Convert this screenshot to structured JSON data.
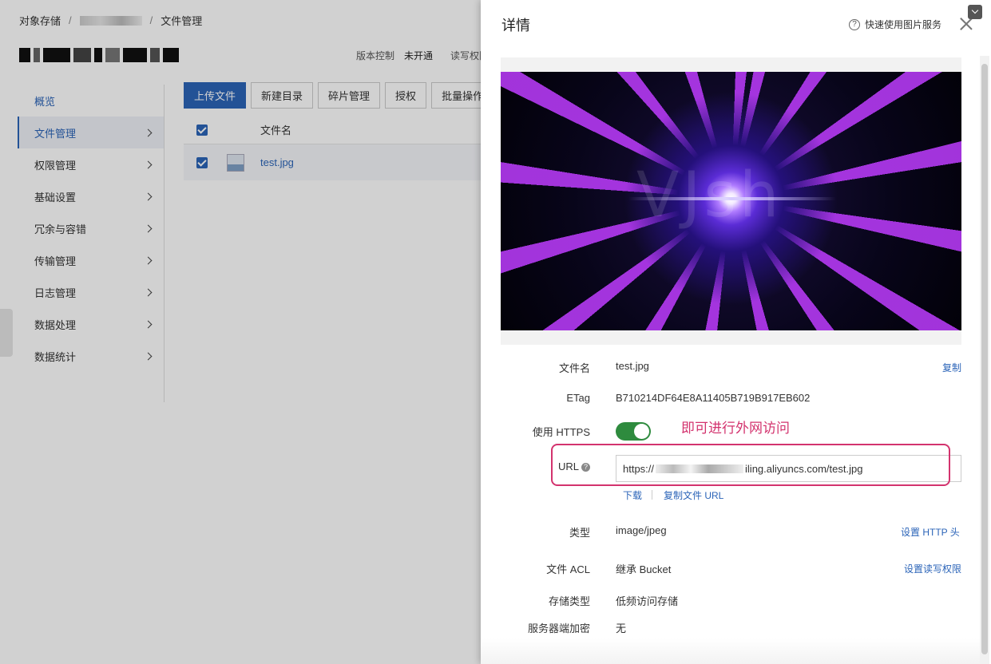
{
  "breadcrumb": {
    "root": "对象存储",
    "sep": "/",
    "current": "文件管理"
  },
  "bucket": {
    "version_label": "版本控制",
    "version_value": "未开通",
    "rw_label": "读写权限"
  },
  "sidebar": {
    "items": [
      {
        "label": "概览"
      },
      {
        "label": "文件管理"
      },
      {
        "label": "权限管理"
      },
      {
        "label": "基础设置"
      },
      {
        "label": "冗余与容错"
      },
      {
        "label": "传输管理"
      },
      {
        "label": "日志管理"
      },
      {
        "label": "数据处理"
      },
      {
        "label": "数据统计"
      }
    ]
  },
  "toolbar": {
    "upload": "上传文件",
    "new_dir": "新建目录",
    "fragments": "碎片管理",
    "authorize": "授权",
    "batch": "批量操作"
  },
  "table": {
    "col_name": "文件名",
    "rows": [
      {
        "name": "test.jpg",
        "checked": true
      }
    ]
  },
  "drawer": {
    "title": "详情",
    "help_text": "快速使用图片服务",
    "preview_watermark": "VJsh",
    "fields": {
      "filename_label": "文件名",
      "filename_value": "test.jpg",
      "copy": "复制",
      "etag_label": "ETag",
      "etag_value": "B710214DF64E8A11405B719B917EB602",
      "https_label": "使用 HTTPS",
      "https_on": true,
      "url_label": "URL",
      "url_prefix": "https://",
      "url_suffix": "iling.aliyuncs.com/test.jpg",
      "download": "下载",
      "copy_url": "复制文件 URL",
      "type_label": "类型",
      "type_value": "image/jpeg",
      "set_http_header": "设置 HTTP 头",
      "acl_label": "文件 ACL",
      "acl_value": "继承 Bucket",
      "set_acl": "设置读写权限",
      "storage_label": "存储类型",
      "storage_value": "低频访问存储",
      "encrypt_label": "服务器端加密",
      "encrypt_value": "无"
    },
    "annotation": "即可进行外网访问"
  },
  "colors": {
    "accent": "#2b64b8",
    "annotation": "#d3336e",
    "toggle_on": "#2e8b3e"
  }
}
